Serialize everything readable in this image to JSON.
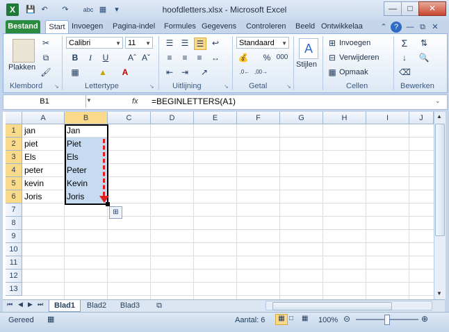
{
  "window": {
    "title": "hoofdletters.xlsx - Microsoft Excel",
    "app_icon": "X"
  },
  "ribbon_tabs": [
    "Bestand",
    "Start",
    "Invoegen",
    "Pagina-indel",
    "Formules",
    "Gegevens",
    "Controleren",
    "Beeld",
    "Ontwikkelaa"
  ],
  "clipboard": {
    "paste_label": "Plakken",
    "group_label": "Klembord"
  },
  "font": {
    "name": "Calibri",
    "size": "11",
    "group_label": "Lettertype"
  },
  "alignment": {
    "group_label": "Uitlijning"
  },
  "number": {
    "format": "Standaard",
    "group_label": "Getal",
    "percent": "%",
    "thousands": "000"
  },
  "styles": {
    "label": "Stijlen"
  },
  "cells": {
    "insert": "Invoegen",
    "delete": "Verwijderen",
    "format": "Opmaak",
    "group_label": "Cellen"
  },
  "editing": {
    "group_label": "Bewerken"
  },
  "formula_bar": {
    "name_box": "B1",
    "fx": "fx",
    "formula": "=BEGINLETTERS(A1)"
  },
  "columns": [
    "A",
    "B",
    "C",
    "D",
    "E",
    "F",
    "G",
    "H",
    "I",
    "J"
  ],
  "rows": [
    "1",
    "2",
    "3",
    "4",
    "5",
    "6",
    "7",
    "8",
    "9",
    "10",
    "11",
    "12",
    "13"
  ],
  "cells_data": {
    "colA": [
      "jan",
      "piet",
      "Els",
      "peter",
      "kevin",
      "Joris"
    ],
    "colB": [
      "Jan",
      "Piet",
      "Els",
      "Peter",
      "Kevin",
      "Joris"
    ]
  },
  "sheets": [
    "Blad1",
    "Blad2",
    "Blad3"
  ],
  "status": {
    "mode": "Gereed",
    "count": "Aantal: 6",
    "zoom": "100%"
  },
  "colors": {
    "accent_green": "#2a8a3e",
    "selection_fill": "#c6dbf1",
    "header_highlight": "#f9d98a",
    "fill_arrow": "#e02020"
  }
}
